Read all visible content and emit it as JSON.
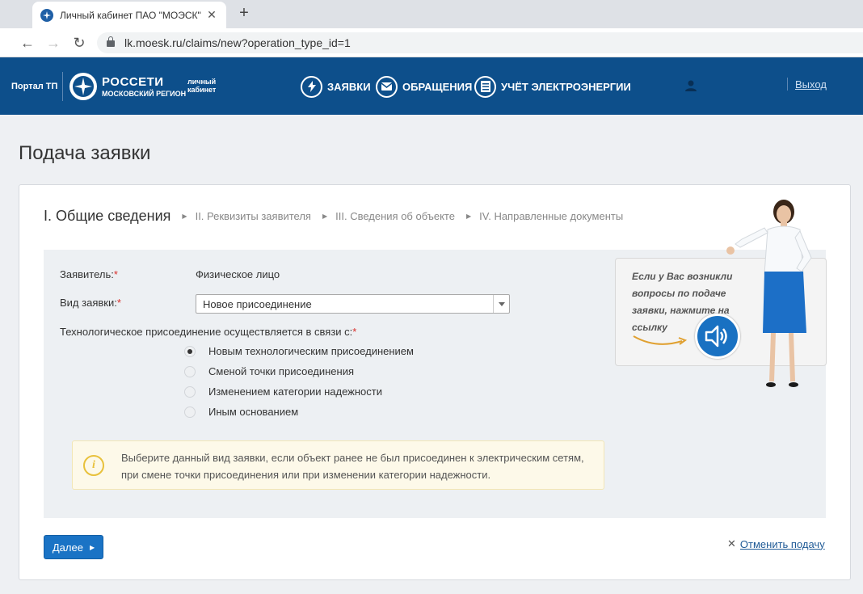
{
  "browser": {
    "tab_title": "Личный кабинет ПАО \"МОЭСК\"",
    "url": "lk.moesk.ru/claims/new?operation_type_id=1"
  },
  "header": {
    "portal_label": "Портал ТП",
    "brand_name": "РОССЕТИ",
    "brand_region": "МОСКОВСКИЙ РЕГИОН",
    "cabinet_label": "личный кабинет",
    "menu": [
      {
        "label": "ЗАЯВКИ",
        "icon": "lightning-icon"
      },
      {
        "label": "ОБРАЩЕНИЯ",
        "icon": "mail-icon"
      },
      {
        "label": "УЧЁТ ЭЛЕКТРОЭНЕРГИИ",
        "icon": "meter-icon"
      }
    ],
    "logout": "Выход"
  },
  "page": {
    "title": "Подача заявки"
  },
  "steps": [
    "I. Общие сведения",
    "II. Реквизиты заявителя",
    "III. Сведения об объекте",
    "IV. Направленные документы"
  ],
  "form": {
    "applicant_label": "Заявитель:",
    "applicant_value": "Физическое лицо",
    "type_label": "Вид заявки:",
    "type_value": "Новое присоединение",
    "reason_label": "Технологическое присоединение осуществляется в связи с:",
    "reasons": [
      {
        "label": "Новым технологическим присоединением",
        "selected": true
      },
      {
        "label": "Сменой точки присоединения",
        "selected": false
      },
      {
        "label": "Изменением категории надежности",
        "selected": false
      },
      {
        "label": "Иным основанием",
        "selected": false
      }
    ],
    "info_text": "Выберите данный вид заявки, если объект ранее не был присоединен к электрическим сетям, при смене точки присоединения или при изменении категории надежности."
  },
  "help": {
    "text": "Если у Вас возникли вопросы по подаче заявки, нажмите на ссылку"
  },
  "actions": {
    "next": "Далее",
    "cancel": "Отменить подачу"
  },
  "colors": {
    "header_bg": "#0d4f8b",
    "primary_button": "#1a73c5",
    "required": "#d9302c",
    "info_bg": "#fdf9e9"
  }
}
